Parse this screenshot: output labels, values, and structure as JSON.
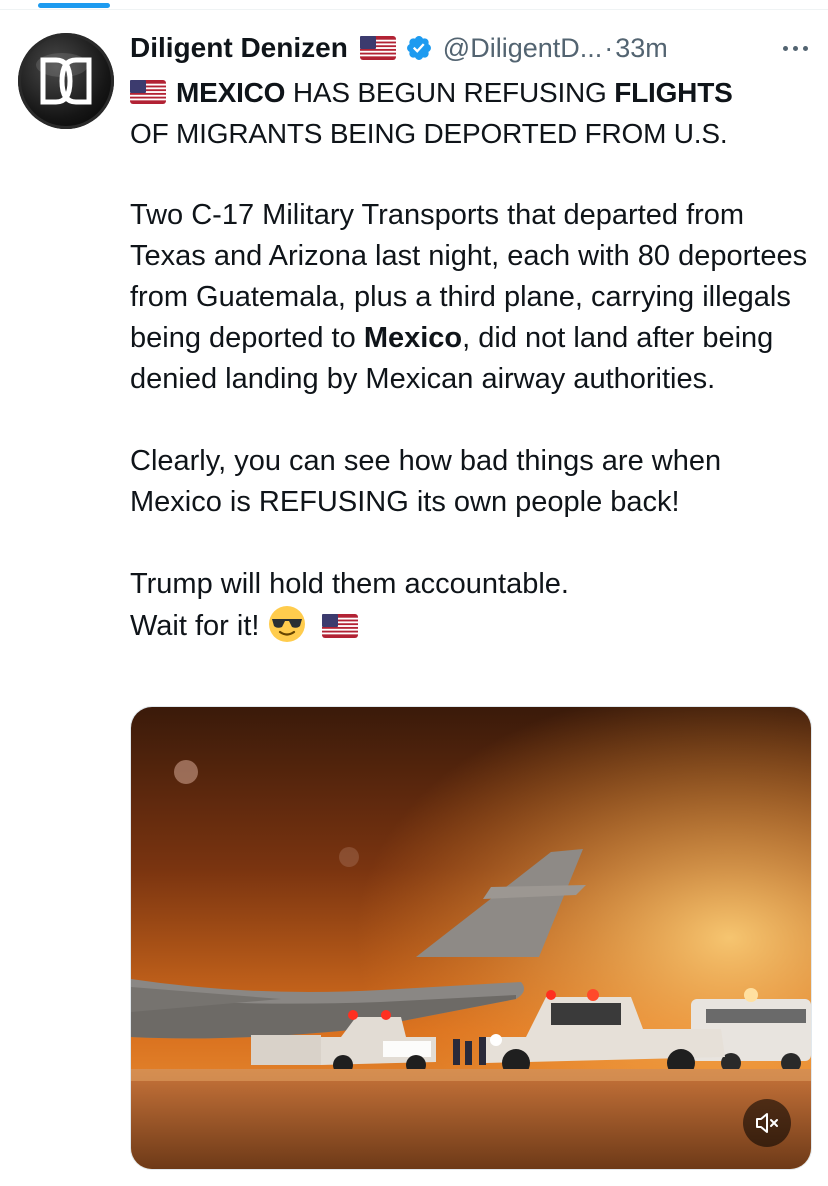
{
  "header": {
    "display_name": "Diligent Denizen",
    "handle": "@DiligentD...",
    "separator": "·",
    "time": "33m"
  },
  "icons": {
    "avatar_logo": "dd-logo-icon",
    "verified": "verified-badge-icon",
    "flag": "us-flag-icon",
    "emoji": "sunglasses-emoji-icon",
    "more": "more-options-icon",
    "mute": "muted-speaker-icon"
  },
  "colors": {
    "accent": "#1d9bf0",
    "text": "#0f1419",
    "secondary_text": "#536471"
  },
  "tweet": {
    "headline_1": "MEXICO",
    "headline_2": " HAS BEGUN REFUSING ",
    "headline_3": "FLIGHTS",
    "headline_4": "OF MIGRANTS BEING DEPORTED FROM U.S.",
    "para1_a": "Two C-17 Military Transports that departed from Texas and Arizona last night, each with 80 deportees from Guatemala, plus a third plane, carrying illegals being deported to ",
    "para1_bold": "Mexico",
    "para1_b": ", did not land after being denied landing by Mexican airway authorities.",
    "para2": "Clearly, you can see how bad things are when Mexico is REFUSING its own people back!",
    "para3_line1": "Trump will hold them accountable.",
    "para3_line2": "Wait for it! "
  },
  "media": {
    "type": "video",
    "muted": true
  }
}
